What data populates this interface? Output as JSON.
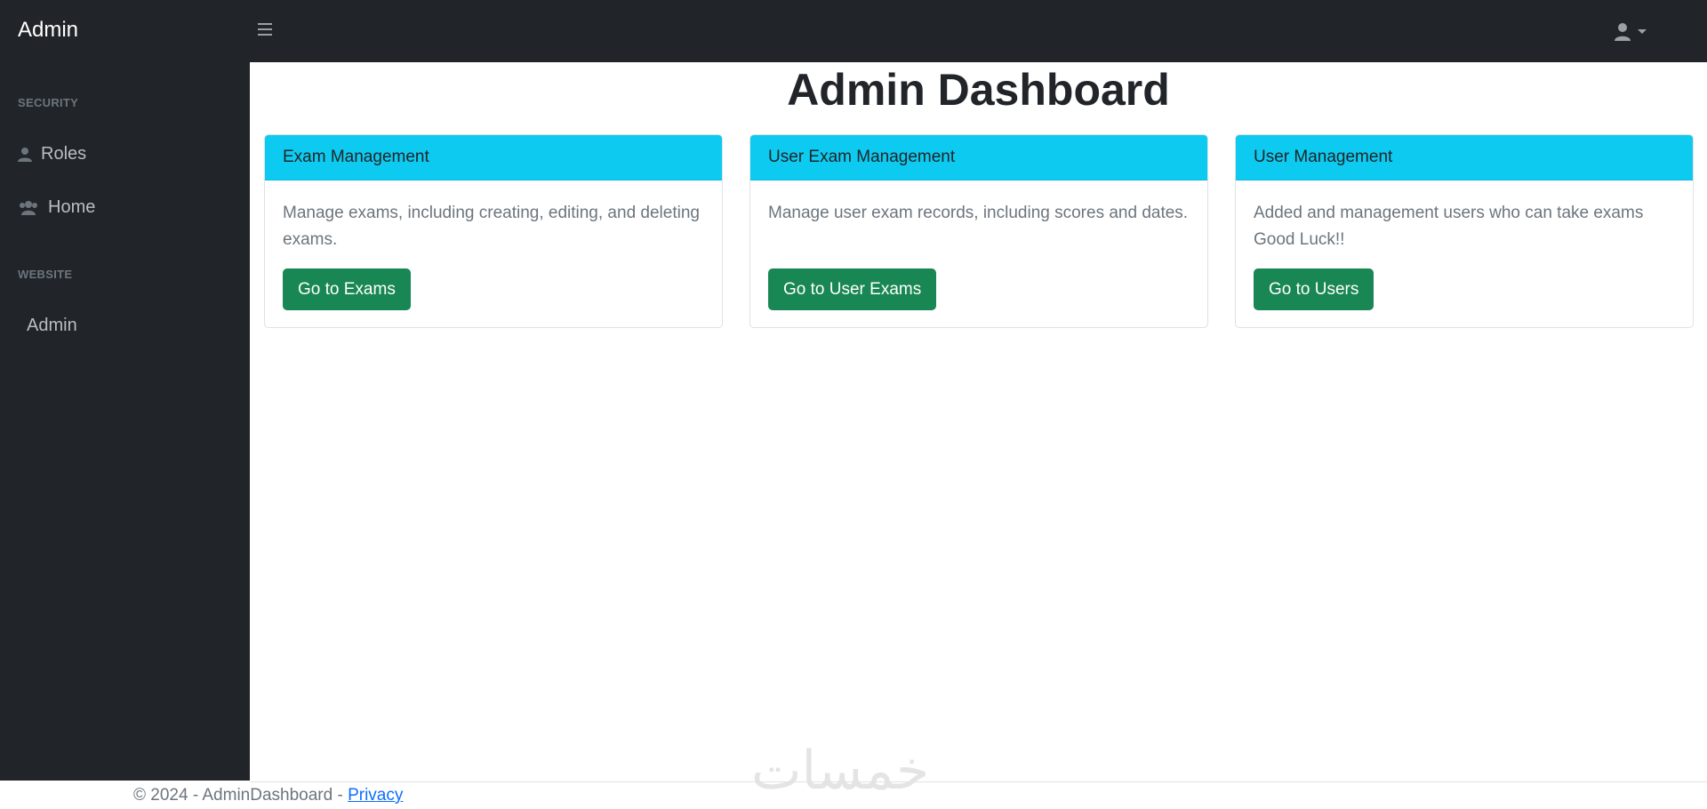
{
  "header": {
    "brand": "Admin",
    "menu_toggle_icon": "hamburger-icon",
    "user_icon": "user-icon",
    "dropdown_icon": "caret-down-icon"
  },
  "sidebar": {
    "sections": [
      {
        "heading": "SECURITY",
        "items": [
          {
            "label": "Roles",
            "icon": "user-icon"
          },
          {
            "label": "Home",
            "icon": "users-icon"
          }
        ]
      },
      {
        "heading": "WEBSITE",
        "items": [
          {
            "label": "Admin",
            "icon": ""
          }
        ]
      }
    ]
  },
  "main": {
    "title": "Admin Dashboard",
    "cards": [
      {
        "title": "Exam Management",
        "text": "Manage exams, including creating, editing, and deleting exams.",
        "button": "Go to Exams"
      },
      {
        "title": "User Exam Management",
        "text": "Manage user exam records, including scores and dates.",
        "button": "Go to User Exams"
      },
      {
        "title": "User Management",
        "text": "Added and management users who can take exams Good Luck!!",
        "button": "Go to Users"
      }
    ]
  },
  "footer": {
    "text": "© 2024 - AdminDashboard - ",
    "link": "Privacy"
  },
  "watermark": "خمسات",
  "colors": {
    "dark": "#212529",
    "card_header": "#0dcaf0",
    "button": "#198754",
    "link": "#0d6efd"
  }
}
